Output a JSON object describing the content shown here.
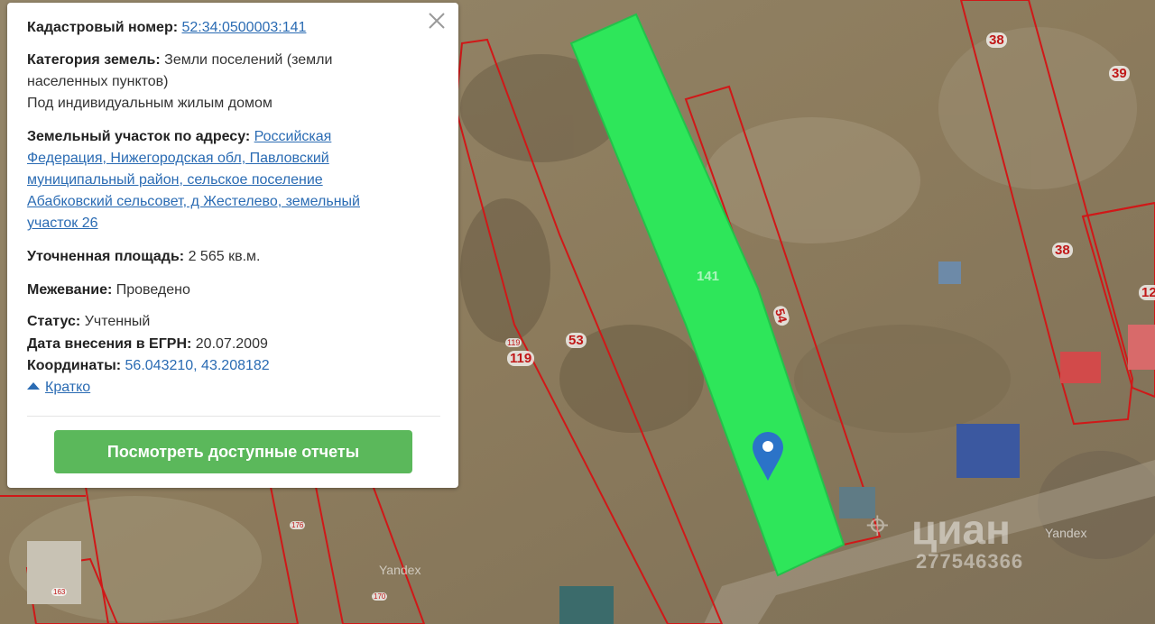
{
  "map": {
    "plot_labels": [
      "38",
      "39",
      "38",
      "12",
      "53",
      "119",
      "119",
      "54",
      "141",
      "176",
      "170",
      "163"
    ],
    "watermark_brand": "циан",
    "watermark_id": "277546366",
    "provider_labels": [
      "Yandex",
      "Yandex"
    ]
  },
  "panel": {
    "cadastral": {
      "label": "Кадастровый номер:",
      "value": "52:34:0500003:141"
    },
    "category": {
      "label": "Категория земель:",
      "value_line1": "Земли поселений (земли",
      "value_line2": "населенных пунктов)",
      "use": "Под индивидуальным жилым домом"
    },
    "address": {
      "label": "Земельный участок по адресу:",
      "line1": "Российская",
      "line2": "Федерация, Нижегородская обл, Павловский",
      "line3": "муниципальный район, сельское поселение",
      "line4": "Абабковский сельсовет, д Жестелево, земельный",
      "line5": "участок 26"
    },
    "area": {
      "label": "Уточненная площадь:",
      "value": "2 565 кв.м."
    },
    "survey": {
      "label": "Межевание:",
      "value": "Проведено"
    },
    "status": {
      "label": "Статус:",
      "value": "Учтенный"
    },
    "date": {
      "label": "Дата внесения в ЕГРН:",
      "value": "20.07.2009"
    },
    "coords": {
      "label": "Координаты:",
      "value": "56.043210, 43.208182"
    },
    "collapse_label": "Кратко",
    "button_label": "Посмотреть доступные отчеты"
  },
  "colors": {
    "highlight": "#2ee65a",
    "boundary": "#d01818",
    "button": "#5bb85b",
    "link": "#2a6bb3"
  }
}
